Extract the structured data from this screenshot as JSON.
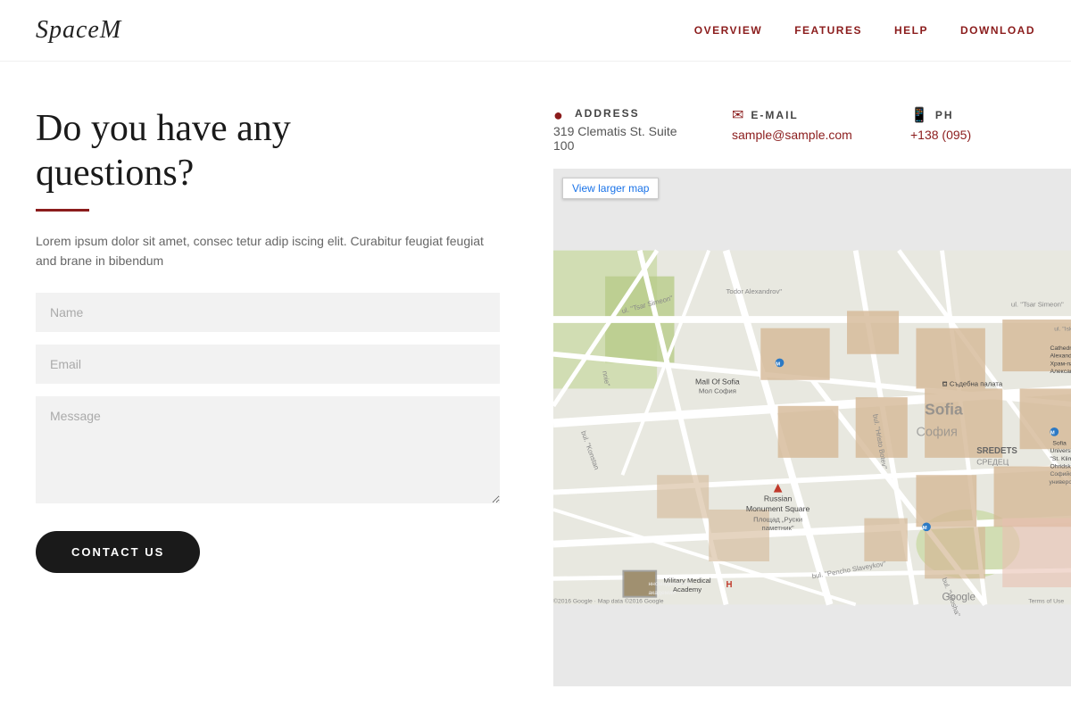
{
  "nav": {
    "logo": "SpaceM",
    "links": [
      "OVERVIEW",
      "FEATURES",
      "HELP",
      "DOWNLOAD"
    ]
  },
  "hero": {
    "heading_line1": "Do you have any",
    "heading_line2": "questions?",
    "description": "Lorem ipsum dolor sit amet, consec tetur adip iscing elit. Curabitur feugiat feugiat and brane in bibendum"
  },
  "form": {
    "name_placeholder": "Name",
    "email_placeholder": "Email",
    "message_placeholder": "Message",
    "submit_label": "CONTACT US"
  },
  "contact": {
    "address_label": "ADDRESS",
    "address_value": "319 Clematis St. Suite 100",
    "email_label": "E-MAIL",
    "email_value": "sample@sample.com",
    "phone_label": "PH",
    "phone_value": "+138 (095)"
  },
  "map": {
    "view_larger": "View larger map",
    "city": "Sofia",
    "city_cyrillic": "София",
    "google_label": "Google",
    "copyright": "©2016 Google · Map data ©2016 Google",
    "terms": "Terms of Use"
  }
}
